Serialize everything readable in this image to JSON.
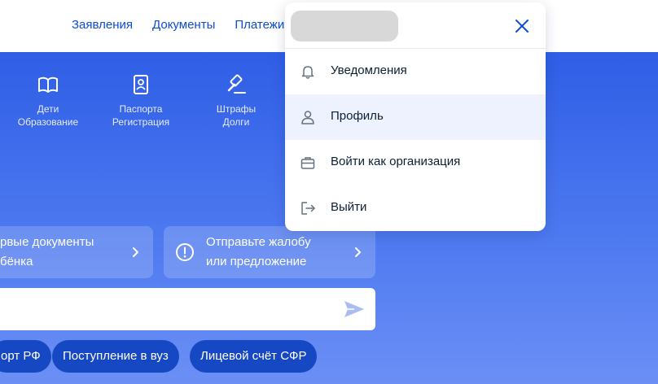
{
  "nav": {
    "items": [
      "Заявления",
      "Документы",
      "Платежи"
    ]
  },
  "categories": [
    {
      "icon": "book-icon",
      "line1": "Дети",
      "line2": "Образование"
    },
    {
      "icon": "passport-icon",
      "line1": "Паспорта",
      "line2": "Регистрация"
    },
    {
      "icon": "gavel-icon",
      "line1": "Штрафы",
      "line2": "Долги"
    }
  ],
  "cards": [
    {
      "line1": "рвые документы",
      "line2": "бёнка"
    },
    {
      "icon": "exclamation-circle-icon",
      "line1": "Отправьте жалобу",
      "line2": "или предложение"
    }
  ],
  "search": {
    "placeholder": "",
    "send_icon": "send-icon"
  },
  "chips": [
    "орт РФ",
    "Поступление в вуз",
    "Лицевой счёт СФР"
  ],
  "menu": {
    "items": [
      {
        "icon": "bell-icon",
        "label": "Уведомления"
      },
      {
        "icon": "user-icon",
        "label": "Профиль",
        "active": true
      },
      {
        "icon": "briefcase-icon",
        "label": "Войти как организация"
      },
      {
        "icon": "logout-icon",
        "label": "Выйти"
      }
    ]
  },
  "colors": {
    "brand_blue": "#0d4cd3",
    "hero_blue": "#2f5ee6",
    "chip_blue": "#1748c4",
    "active_item_bg": "#edf2fe"
  }
}
